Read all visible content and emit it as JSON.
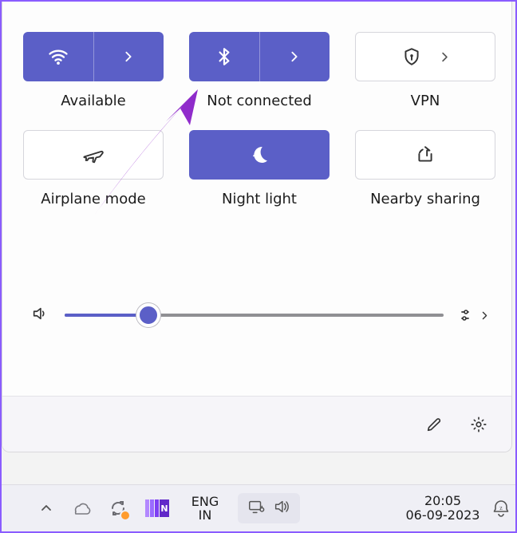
{
  "tiles": {
    "wifi": {
      "label": "Available",
      "state": "on",
      "split": true
    },
    "bluetooth": {
      "label": "Not connected",
      "state": "on",
      "split": true
    },
    "vpn": {
      "label": "VPN",
      "state": "off",
      "split": false
    },
    "airplane": {
      "label": "Airplane mode",
      "state": "off",
      "split": false
    },
    "nightlight": {
      "label": "Night light",
      "state": "on",
      "split": false
    },
    "nearby": {
      "label": "Nearby sharing",
      "state": "off",
      "split": false
    }
  },
  "volume": {
    "percent": 22
  },
  "taskbar": {
    "language": {
      "line1": "ENG",
      "line2": "IN"
    },
    "clock": {
      "time": "20:05",
      "date": "06-09-2023"
    },
    "onenote_letter": "N"
  },
  "colors": {
    "accent": "#5b5fc7",
    "annotation": "#a23bd8"
  }
}
